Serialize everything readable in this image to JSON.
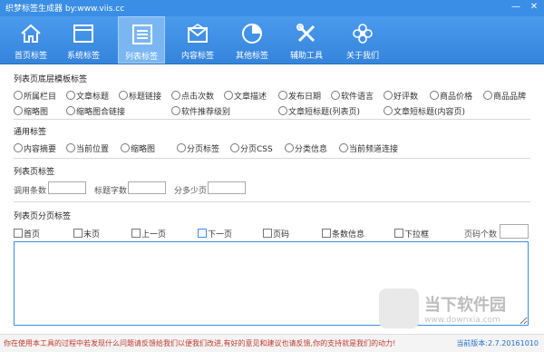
{
  "app": {
    "title": "织梦标签生成器   by:www.viis.cc"
  },
  "window_controls": {
    "minimize": "—",
    "close": "✕"
  },
  "toolbar": {
    "items": [
      {
        "label": "首页标签",
        "icon": "home-icon"
      },
      {
        "label": "系统标签",
        "icon": "window-icon"
      },
      {
        "label": "列表标签",
        "icon": "list-icon",
        "active": true
      },
      {
        "label": "内容标签",
        "icon": "envelope-icon"
      },
      {
        "label": "其他标签",
        "icon": "pie-chart-icon"
      },
      {
        "label": "辅助工具",
        "icon": "tools-icon"
      },
      {
        "label": "关于我们",
        "icon": "flower-icon"
      }
    ]
  },
  "sections": {
    "list_bottom_template": {
      "title": "列表页底层模板标签",
      "options": [
        "所属栏目",
        "文章标题",
        "标题链接",
        "点击次数",
        "文章描述",
        "发布日期",
        "软件语言",
        "好评数",
        "商品价格",
        "商品品牌",
        "缩略图",
        "缩略图合链接",
        "软件推荐级别",
        "文章短标题(列表页)",
        "文章短标题(内容页)"
      ]
    },
    "common": {
      "title": "通用标签",
      "options": [
        "内容摘要",
        "当前位置",
        "缩略图",
        "分页标签",
        "分页CSS",
        "分类信息",
        "当前频道连接"
      ]
    },
    "list_page": {
      "title": "列表页标签",
      "fields": [
        {
          "label": "调用条数",
          "value": ""
        },
        {
          "label": "标题字数",
          "value": ""
        },
        {
          "label": "分多少页",
          "value": ""
        }
      ]
    },
    "pagination": {
      "title": "列表页分页标签",
      "options": [
        "首页",
        "末页",
        "上一页",
        "下一页",
        "页码",
        "条数信息",
        "下拉框"
      ],
      "page_count_label": "页码个数",
      "page_count_value": ""
    }
  },
  "output": {
    "value": ""
  },
  "status": {
    "message": "你在使用本工具的过程中若发现什么问题请反馈给我们以便我们改进,有好的意见和建议也请反馈,你的支持就是我们的动力!",
    "version": "当前版本:2.7.20161010"
  },
  "watermark": {
    "main": "当下软件园",
    "sub": "www.downxia.com"
  }
}
